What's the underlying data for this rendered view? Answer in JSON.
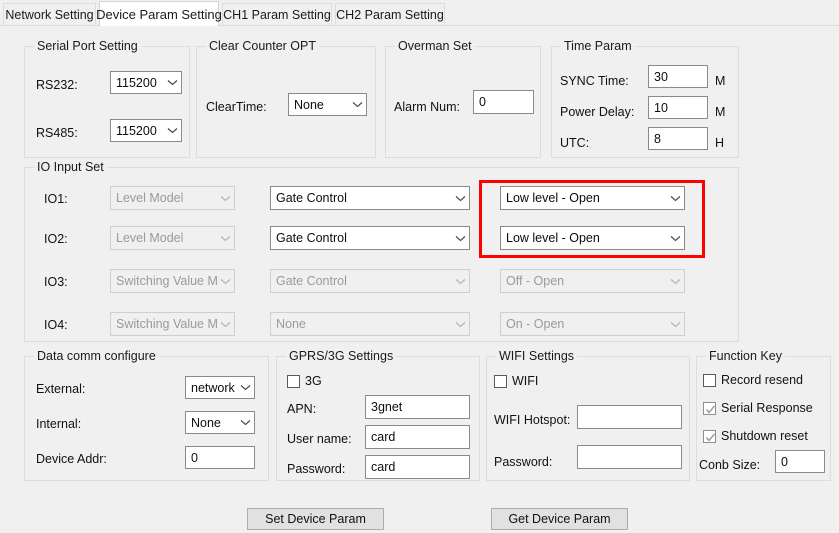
{
  "window": {
    "background_color": "#f0f0f0",
    "highlight_color": "#ff0000"
  },
  "tabs": [
    {
      "label": "Network Setting",
      "active": false
    },
    {
      "label": "Device Param Setting",
      "active": true
    },
    {
      "label": "CH1 Param Setting",
      "active": false
    },
    {
      "label": "CH2 Param Setting",
      "active": false
    }
  ],
  "serial_port_setting": {
    "legend": "Serial Port Setting",
    "rs232_label": "RS232:",
    "rs232_value": "115200",
    "rs485_label": "RS485:",
    "rs485_value": "115200"
  },
  "clear_counter_opt": {
    "legend": "Clear Counter OPT",
    "cleartime_label": "ClearTime:",
    "cleartime_value": "None"
  },
  "overman_set": {
    "legend": "Overman Set",
    "alarm_num_label": "Alarm Num:",
    "alarm_num_value": "0"
  },
  "time_param": {
    "legend": "Time Param",
    "sync_time_label": "SYNC Time:",
    "sync_time_value": "30",
    "sync_time_unit": "M",
    "power_delay_label": "Power Delay:",
    "power_delay_value": "10",
    "power_delay_unit": "M",
    "utc_label": "UTC:",
    "utc_value": "8",
    "utc_unit": "H"
  },
  "io_input_set": {
    "legend": "IO Input Set",
    "rows": [
      {
        "label": "IO1:",
        "mode": "Level Model",
        "mode_enabled": false,
        "func": "Gate Control",
        "func_enabled": true,
        "state": "Low level - Open",
        "state_enabled": true,
        "highlighted": true
      },
      {
        "label": "IO2:",
        "mode": "Level Model",
        "mode_enabled": false,
        "func": "Gate Control",
        "func_enabled": true,
        "state": "Low level - Open",
        "state_enabled": true,
        "highlighted": true
      },
      {
        "label": "IO3:",
        "mode": "Switching Value Model",
        "mode_enabled": false,
        "func": "Gate Control",
        "func_enabled": false,
        "state": "Off - Open",
        "state_enabled": false,
        "highlighted": false
      },
      {
        "label": "IO4:",
        "mode": "Switching Value Model",
        "mode_enabled": false,
        "func": "None",
        "func_enabled": false,
        "state": "On - Open",
        "state_enabled": false,
        "highlighted": false
      }
    ]
  },
  "data_comm_configure": {
    "legend": "Data comm configure",
    "external_label": "External:",
    "external_value": "network",
    "internal_label": "Internal:",
    "internal_value": "None",
    "device_addr_label": "Device Addr:",
    "device_addr_value": "0"
  },
  "gprs_settings": {
    "legend": "GPRS/3G Settings",
    "g3_label": "3G",
    "g3_checked": false,
    "apn_label": "APN:",
    "apn_value": "3gnet",
    "username_label": "User name:",
    "username_value": "card",
    "password_label": "Password:",
    "password_value": "card"
  },
  "wifi_settings": {
    "legend": "WIFI Settings",
    "wifi_label": "WIFI",
    "wifi_checked": false,
    "hotspot_label": "WIFI Hotspot:",
    "hotspot_value": "",
    "password_label": "Password:",
    "password_value": ""
  },
  "function_key": {
    "legend": "Function Key",
    "record_resend_label": "Record resend",
    "record_resend_checked": false,
    "serial_response_label": "Serial Response",
    "serial_response_checked": true,
    "shutdown_reset_label": "Shutdown reset",
    "shutdown_reset_checked": true,
    "conb_size_label": "Conb Size:",
    "conb_size_value": "0"
  },
  "actions": {
    "set_device_param": "Set Device Param",
    "get_device_param": "Get Device Param"
  }
}
